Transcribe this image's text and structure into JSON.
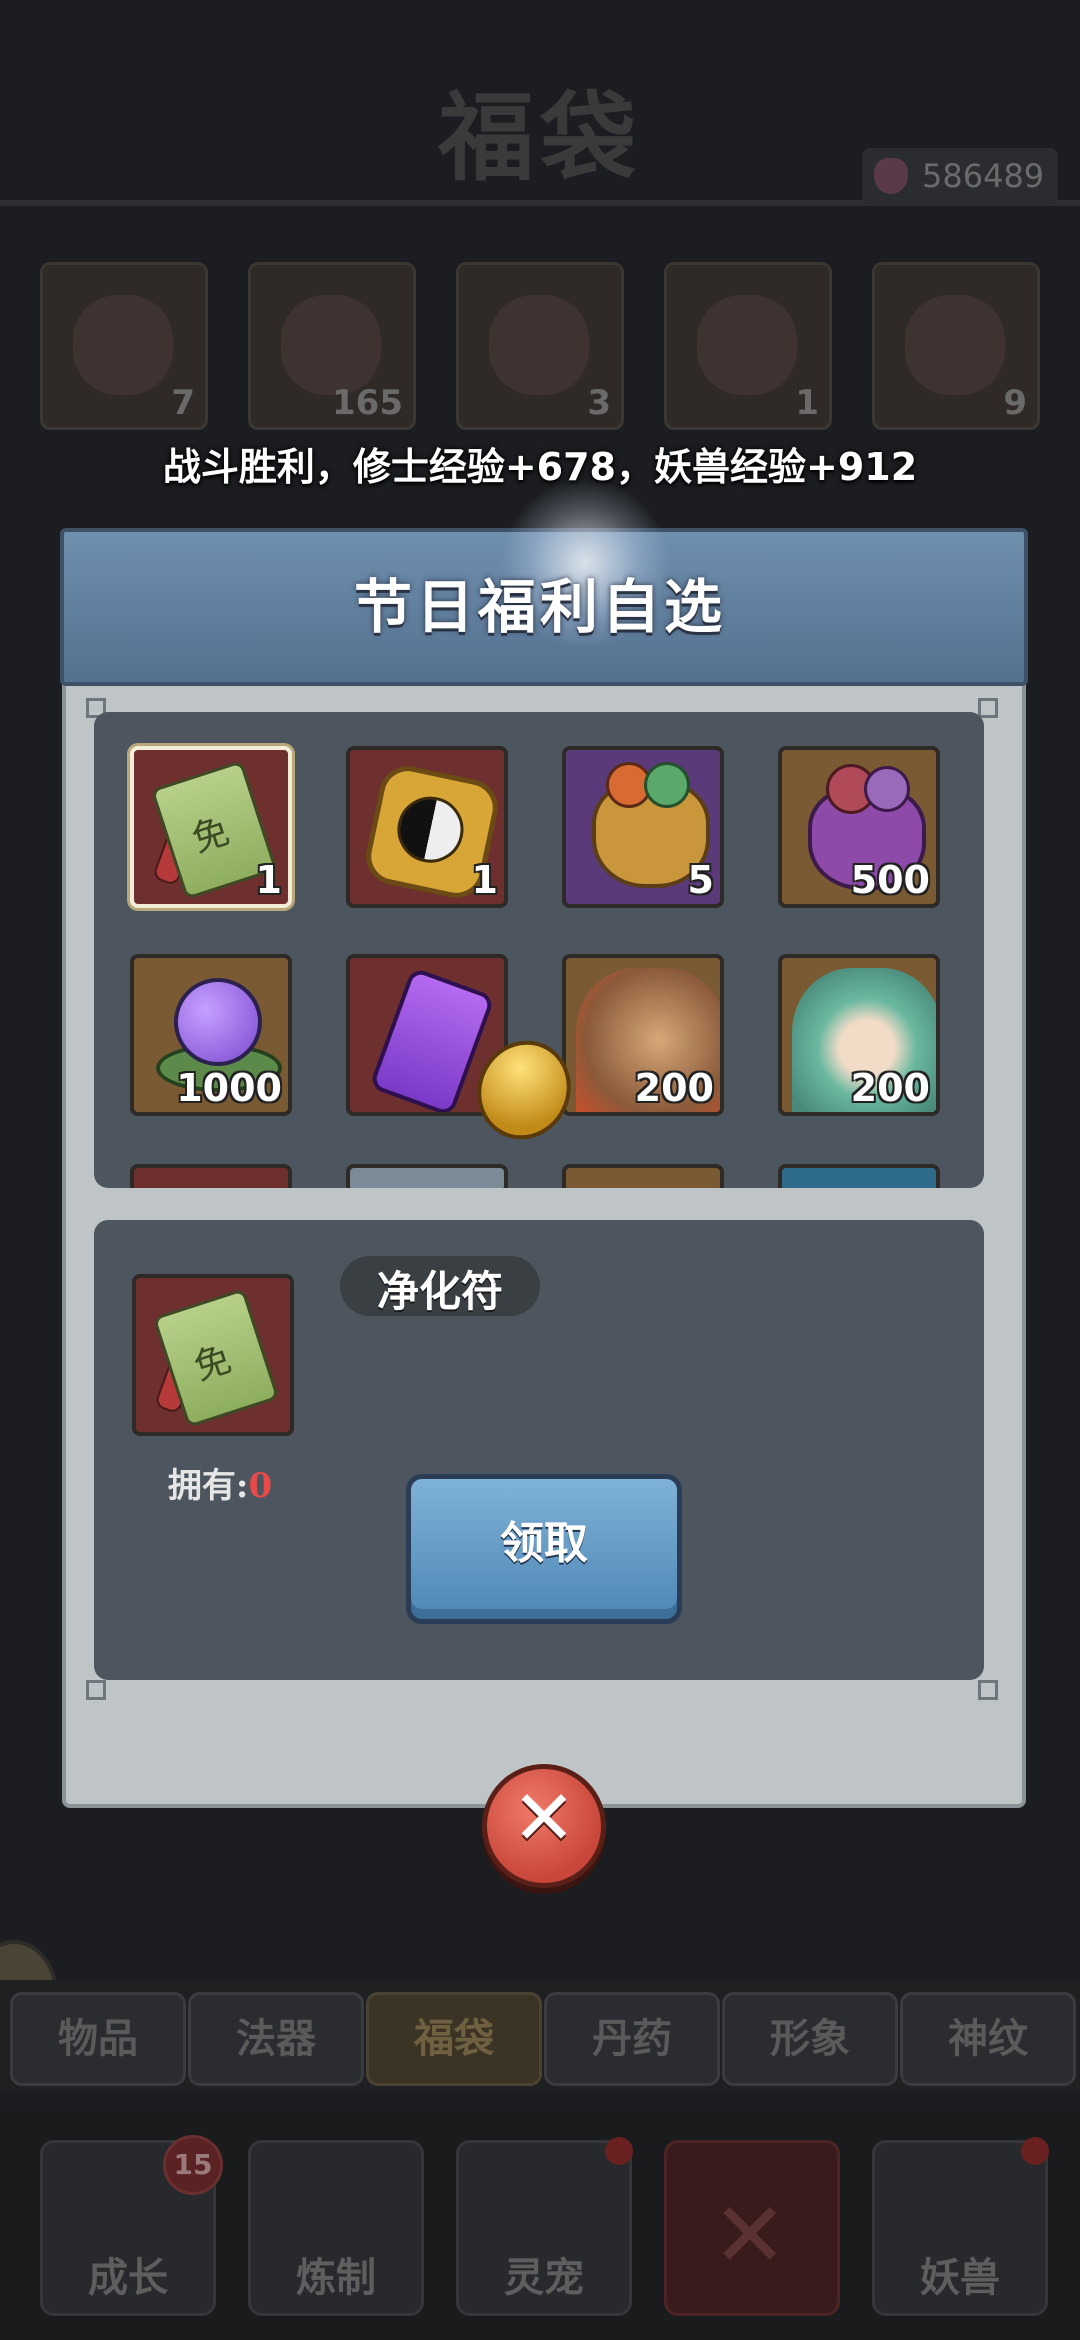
{
  "background": {
    "title": "福袋",
    "currency": "586489",
    "slots": [
      {
        "count": "7"
      },
      {
        "count": "165"
      },
      {
        "count": "3"
      },
      {
        "count": "1"
      },
      {
        "count": "9"
      }
    ],
    "tabs": [
      "物品",
      "法器",
      "福袋",
      "丹药",
      "形象",
      "神纹"
    ],
    "active_tab": "福袋",
    "nav": [
      {
        "label": "成长",
        "badge": "15"
      },
      {
        "label": "炼制"
      },
      {
        "label": "灵宠"
      },
      {
        "label": ""
      },
      {
        "label": "妖兽"
      }
    ]
  },
  "toast": "战斗胜利，修士经验+678，妖兽经验+912",
  "dialog": {
    "title": "节日福利自选",
    "items": [
      {
        "count": "1",
        "icon": "scroll-icon"
      },
      {
        "count": "1",
        "icon": "taiji-token-icon"
      },
      {
        "count": "5",
        "icon": "lucky-bag-icon"
      },
      {
        "count": "500",
        "icon": "purple-bag-icon"
      },
      {
        "count": "1000",
        "icon": "spirit-orb-icon"
      },
      {
        "count": "",
        "icon": "purple-talisman-icon"
      },
      {
        "count": "200",
        "icon": "dragon-portrait-icon"
      },
      {
        "count": "200",
        "icon": "maiden-portrait-icon"
      }
    ],
    "selected": {
      "name": "净化符",
      "own_label": "拥有:",
      "own_value": "0"
    },
    "claim_label": "领取",
    "close_symbol": "✕"
  }
}
